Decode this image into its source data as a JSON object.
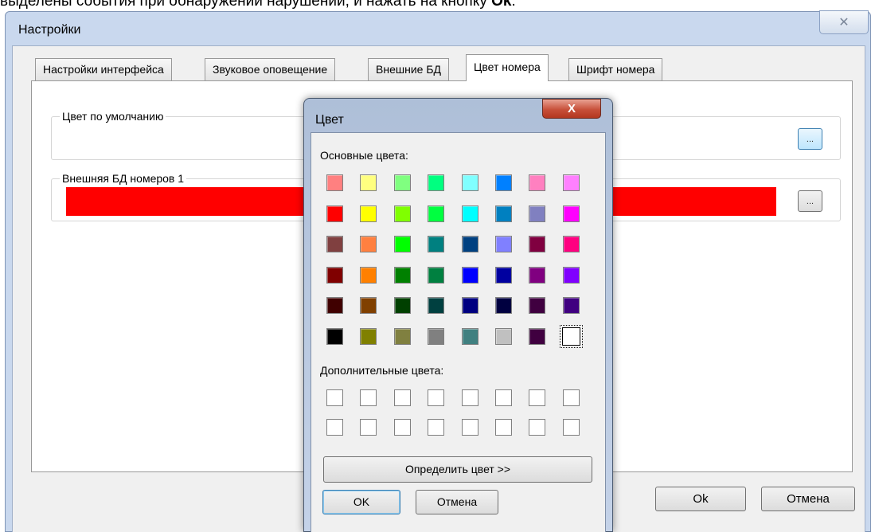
{
  "doc": {
    "text_a": "выделены события при обнаружении нарушений, и нажать на кнопку ",
    "text_b": "Ok",
    "text_c": "."
  },
  "settings_window": {
    "title": "Настройки",
    "close_glyph": "✕",
    "tabs": [
      {
        "label": "Настройки интерфейса",
        "active": false
      },
      {
        "label": "Звуковое оповещение",
        "active": false
      },
      {
        "label": "Внешние БД",
        "active": false
      },
      {
        "label": "Цвет номера",
        "active": true
      },
      {
        "label": "Шрифт номера",
        "active": false
      }
    ],
    "default_color": {
      "label": "Цвет по умолчанию",
      "button_label": "..."
    },
    "external_db_color": {
      "label": "Внешняя БД номеров 1",
      "color": "#ff0000",
      "button_label": "..."
    },
    "ok_label": "Ok",
    "cancel_label": "Отмена"
  },
  "color_dialog": {
    "title": "Цвет",
    "close_glyph": "X",
    "basic_colors_label": "Основные цвета:",
    "basic_colors": [
      [
        "#ff8080",
        "#ffff80",
        "#80ff80",
        "#00ff80",
        "#80ffff",
        "#0080ff",
        "#ff80c0",
        "#ff80ff"
      ],
      [
        "#ff0000",
        "#ffff00",
        "#80ff00",
        "#00ff40",
        "#00ffff",
        "#0080c0",
        "#8080c0",
        "#ff00ff"
      ],
      [
        "#804040",
        "#ff8040",
        "#00ff00",
        "#008080",
        "#004080",
        "#8080ff",
        "#800040",
        "#ff0080"
      ],
      [
        "#800000",
        "#ff8000",
        "#008000",
        "#008040",
        "#0000ff",
        "#0000a0",
        "#800080",
        "#8000ff"
      ],
      [
        "#400000",
        "#804000",
        "#004000",
        "#004040",
        "#000080",
        "#000040",
        "#400040",
        "#400080"
      ],
      [
        "#000000",
        "#808000",
        "#808040",
        "#808080",
        "#408080",
        "#c0c0c0",
        "#400040",
        "#ffffff"
      ]
    ],
    "selected_color": "#ffffff",
    "custom_colors_label": "Дополнительные цвета:",
    "custom_colors": [
      [
        "#ffffff",
        "#ffffff",
        "#ffffff",
        "#ffffff",
        "#ffffff",
        "#ffffff",
        "#ffffff",
        "#ffffff"
      ],
      [
        "#ffffff",
        "#ffffff",
        "#ffffff",
        "#ffffff",
        "#ffffff",
        "#ffffff",
        "#ffffff",
        "#ffffff"
      ]
    ],
    "define_label": "Определить цвет >>",
    "ok_label": "OK",
    "cancel_label": "Отмена"
  }
}
